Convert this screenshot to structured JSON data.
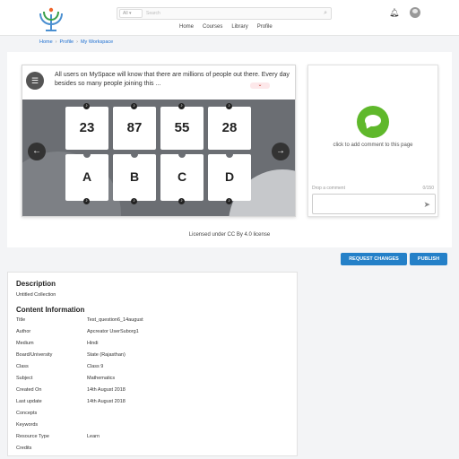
{
  "header": {
    "logo": "diksha-logo",
    "search": {
      "selected": "All",
      "placeholder": "Search"
    },
    "nav": [
      "Home",
      "Courses",
      "Library",
      "Profile"
    ]
  },
  "breadcrumb": [
    "Home",
    "Profile",
    "My Workspace"
  ],
  "player": {
    "question": "All users on MySpace will know that there are millions of people out there. Every day besides so many people joining this ...",
    "numbers": [
      "23",
      "87",
      "55",
      "28"
    ],
    "letters": [
      "A",
      "B",
      "C",
      "D"
    ]
  },
  "comments": {
    "cta": "click to add comment to this page",
    "drop_label": "Drop a comment",
    "count": "0/150"
  },
  "license": "Licensed under CC By 4.0 license",
  "buttons": {
    "request": "REQUEST CHANGES",
    "publish": "PUBLISH"
  },
  "details": {
    "description_title": "Description",
    "description": "Untitled Collection",
    "content_title": "Content Information",
    "rows": [
      {
        "key": "Title",
        "value": "Test_question6_14august"
      },
      {
        "key": "Author",
        "value": "Apcreator UserSuborg1"
      },
      {
        "key": "Medium",
        "value": "Hindi"
      },
      {
        "key": "Board/University",
        "value": "State (Rajasthan)"
      },
      {
        "key": "Class",
        "value": "Class 9"
      },
      {
        "key": "Subject",
        "value": "Mathematics"
      },
      {
        "key": "Created On",
        "value": "14th August 2018"
      },
      {
        "key": "Last update",
        "value": "14th August 2018"
      },
      {
        "key": "Concepts",
        "value": ""
      },
      {
        "key": "Keywords",
        "value": ""
      },
      {
        "key": "Resource Type",
        "value": "Learn"
      },
      {
        "key": "Credits",
        "value": ""
      }
    ]
  },
  "colors": {
    "primary": "#2480c8",
    "link": "#1d6fd1",
    "comment_green": "#5fb82b"
  }
}
